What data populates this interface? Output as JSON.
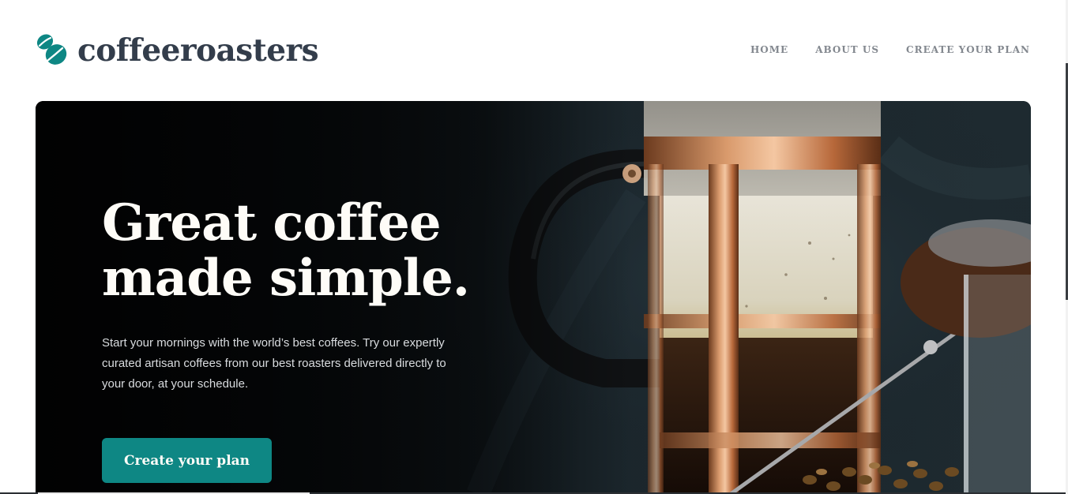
{
  "brand": {
    "name": "coffeeroasters",
    "icon": "coffee-beans-icon",
    "color_text": "#333d4b",
    "color_accent": "#0e8784"
  },
  "nav": {
    "items": [
      {
        "label": "HOME"
      },
      {
        "label": "ABOUT US"
      },
      {
        "label": "CREATE YOUR PLAN"
      }
    ]
  },
  "hero": {
    "title_line1": "Great coffee",
    "title_line2": "made simple.",
    "description": "Start your mornings with the world’s best coffees. Try our expertly curated artisan coffees from our best roasters delivered directly to your door, at your schedule.",
    "cta_label": "Create your plan",
    "image_subject": "french-press-image"
  },
  "colors": {
    "cta_bg": "#0e8784",
    "hero_text": "#fefcf7",
    "nav_text": "#83888f"
  }
}
